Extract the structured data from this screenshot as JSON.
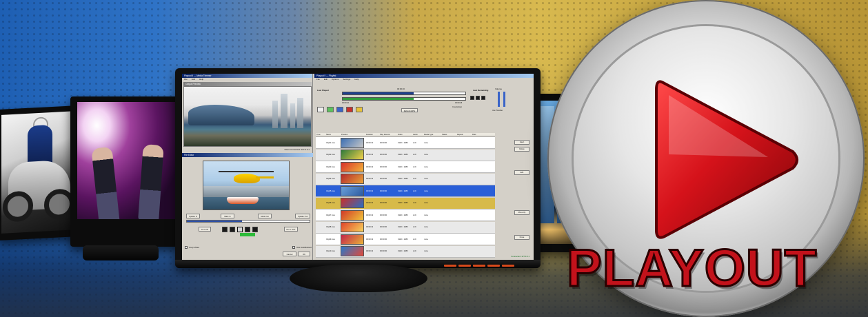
{
  "playout": {
    "label": "PLAYOUT",
    "play_icon": "play-triangle-icon",
    "accent_color": "#c3121b"
  },
  "trimmer_window": {
    "title": "Playout II — Media Trimmer",
    "output_preview_label": "Output Preview",
    "preview_status": "Client connected: 127.0.0.1",
    "trimmer_title": "File Editor",
    "buttons": {
      "update_in": "Update In",
      "mark_in": "Mark In",
      "mark_out": "Mark Out",
      "update_out": "Update Out",
      "go_to_in": "Go to IN",
      "go_to_out": "Go to OUT",
      "cancel": "Cancel",
      "ok": "OK"
    },
    "checks": {
      "loop": "Loop Video",
      "auto_reload": "Use AutoReload"
    }
  },
  "playlist_window": {
    "title": "Playout II — Playlist",
    "menus": [
      "File",
      "Edit",
      "Options",
      "Settings",
      "Help"
    ],
    "now_playing_label": "Last Played",
    "playback_time": "00:00:20",
    "elapsed": "00:00:10",
    "remaining": "00:00:18",
    "next_label": "Last Remaining",
    "timer_label": "Countdown",
    "refresh_button": "Refresh EPG",
    "volume_label": "Volume",
    "mute_label": "Use Timeline",
    "columns": [
      "Time",
      "Name",
      "Preview",
      "Duration",
      "Play Interval",
      "Video",
      "Audio",
      "Media Type",
      "Status",
      "Repeat",
      "Files"
    ],
    "rows": [
      {
        "time": "",
        "name": "Clip01.mov",
        "duration": "00:00:13",
        "interval": "00:00:00",
        "video": "1920 × 1080",
        "audio": "2 ch",
        "type": "none",
        "style": "stripe",
        "thumb": [
          "#3b6fb3",
          "#c7c7c7"
        ]
      },
      {
        "time": "",
        "name": "Clip02.mov",
        "duration": "00:00:13",
        "interval": "00:00:00",
        "video": "1920 × 1080",
        "audio": "2 ch",
        "type": "none",
        "style": "alt",
        "thumb": [
          "#2f7a3a",
          "#f2d14b"
        ]
      },
      {
        "time": "",
        "name": "Clip03.mov",
        "duration": "00:00:13",
        "interval": "00:00:00",
        "video": "1920 × 1080",
        "audio": "2 ch",
        "type": "none",
        "style": "stripe",
        "thumb": [
          "#d8312b",
          "#f3b43a"
        ]
      },
      {
        "time": "",
        "name": "Clip04.mov",
        "duration": "00:00:13",
        "interval": "00:00:00",
        "video": "1920 × 1080",
        "audio": "2 ch",
        "type": "none",
        "style": "alt",
        "thumb": [
          "#b52a2a",
          "#e8a23a"
        ]
      },
      {
        "time": "",
        "name": "Clip05.mov",
        "duration": "00:00:13",
        "interval": "00:00:00",
        "video": "1920 × 1080",
        "audio": "2 ch",
        "type": "none",
        "style": "selected",
        "thumb": [
          "#6aa0d8",
          "#2c5aa0"
        ]
      },
      {
        "time": "",
        "name": "Clip06.mov",
        "duration": "00:00:13",
        "interval": "00:00:00",
        "video": "1920 × 1080",
        "audio": "2 ch",
        "type": "none",
        "style": "next",
        "thumb": [
          "#c92f2a",
          "#2a6fc4"
        ]
      },
      {
        "time": "",
        "name": "Clip07.mov",
        "duration": "00:00:13",
        "interval": "00:00:00",
        "video": "1920 × 1080",
        "audio": "2 ch",
        "type": "none",
        "style": "stripe",
        "thumb": [
          "#d13a28",
          "#f0c23a"
        ]
      },
      {
        "time": "",
        "name": "Clip08.mov",
        "duration": "00:00:13",
        "interval": "00:00:00",
        "video": "1920 × 1080",
        "audio": "2 ch",
        "type": "none",
        "style": "alt",
        "thumb": [
          "#e0442a",
          "#f7d25a"
        ]
      },
      {
        "time": "",
        "name": "Clip09.mov",
        "duration": "00:00:13",
        "interval": "00:00:00",
        "video": "1920 × 1080",
        "audio": "2 ch",
        "type": "none",
        "style": "stripe",
        "thumb": [
          "#c2264a",
          "#e8b13a"
        ]
      },
      {
        "time": "",
        "name": "Clip10.mov",
        "duration": "00:00:13",
        "interval": "00:00:00",
        "video": "1920 × 1080",
        "audio": "2 ch",
        "type": "none",
        "style": "alt",
        "thumb": [
          "#2a78c9",
          "#e24a3a"
        ]
      }
    ],
    "side_buttons": [
      "Insert",
      "Delete",
      "Edit",
      "Move Up",
      "Close"
    ],
    "status": "Connected: 127.0.0.1"
  }
}
